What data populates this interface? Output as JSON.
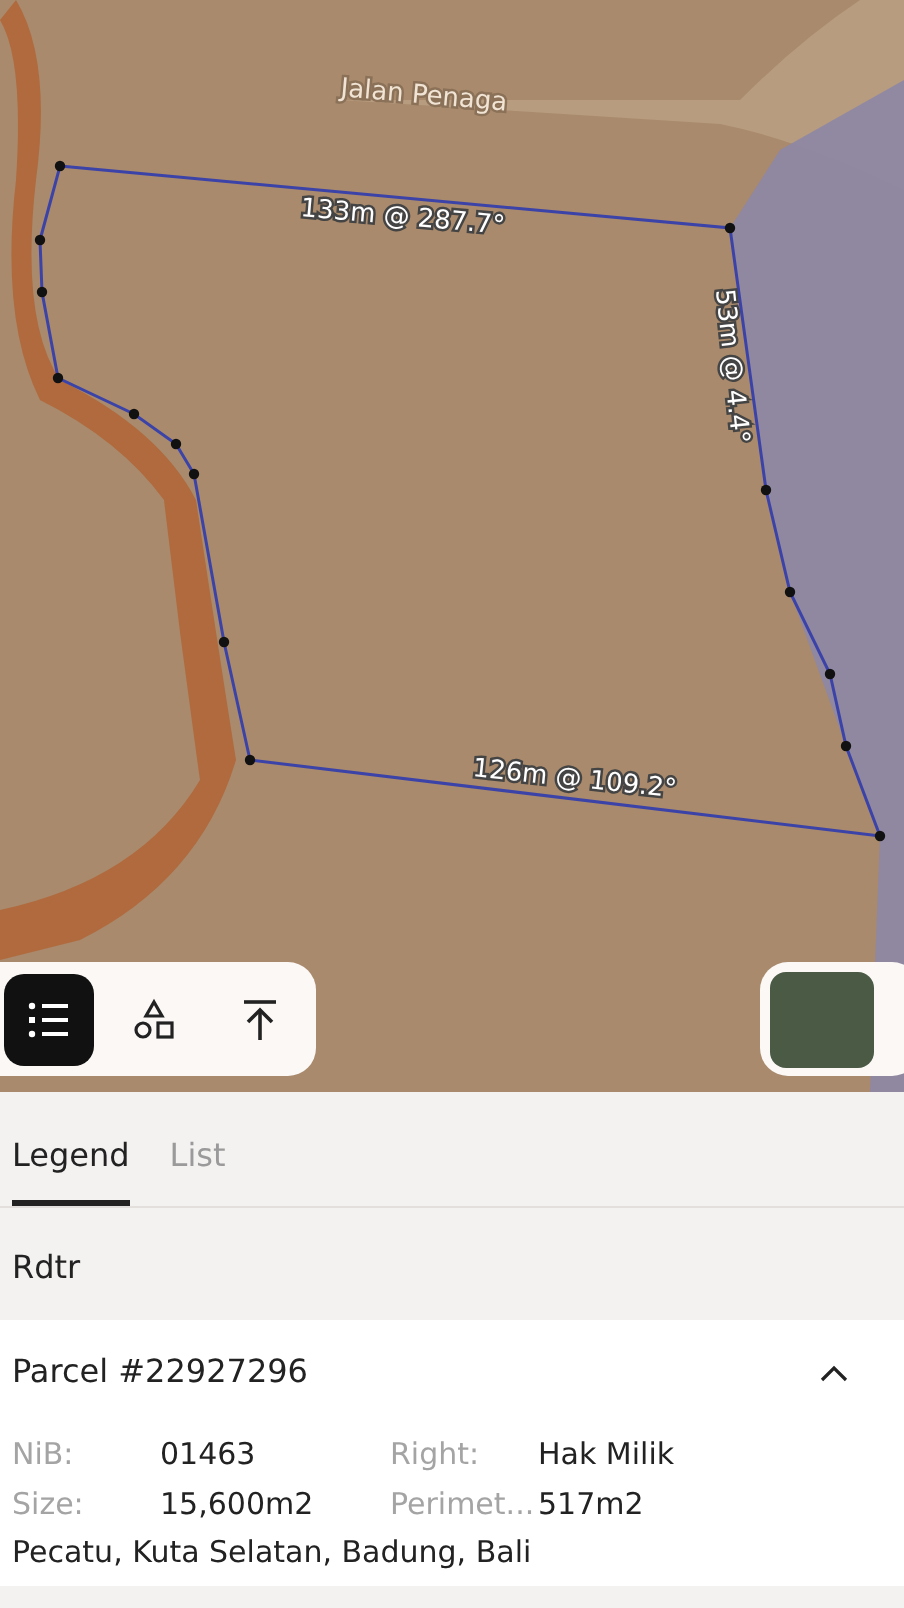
{
  "map": {
    "street_label": "Jalan Penaga",
    "edge_labels": [
      {
        "text": "133m @ 287.7°"
      },
      {
        "text": "53m @ 4.4°"
      },
      {
        "text": "126m @ 109.2°"
      }
    ]
  },
  "toolbar": {
    "buttons": [
      {
        "kind": "legend",
        "selected": true
      },
      {
        "kind": "shapes",
        "selected": false
      },
      {
        "kind": "upload",
        "selected": false
      }
    ]
  },
  "tabs": [
    {
      "label": "Legend",
      "selected": true
    },
    {
      "label": "List",
      "selected": false
    }
  ],
  "legend_items": [
    {
      "label": "Rdtr"
    }
  ],
  "parcel": {
    "title": "Parcel #22927296",
    "expanded": true,
    "fields": [
      {
        "label": "NiB:",
        "value": "01463"
      },
      {
        "label": "Right:",
        "value": "Hak Milik"
      },
      {
        "label": "Size:",
        "value": "15,600m2"
      },
      {
        "label": "Perimet...",
        "value": "517m2"
      }
    ],
    "address": "Pecatu, Kuta Selatan, Badung, Bali"
  }
}
